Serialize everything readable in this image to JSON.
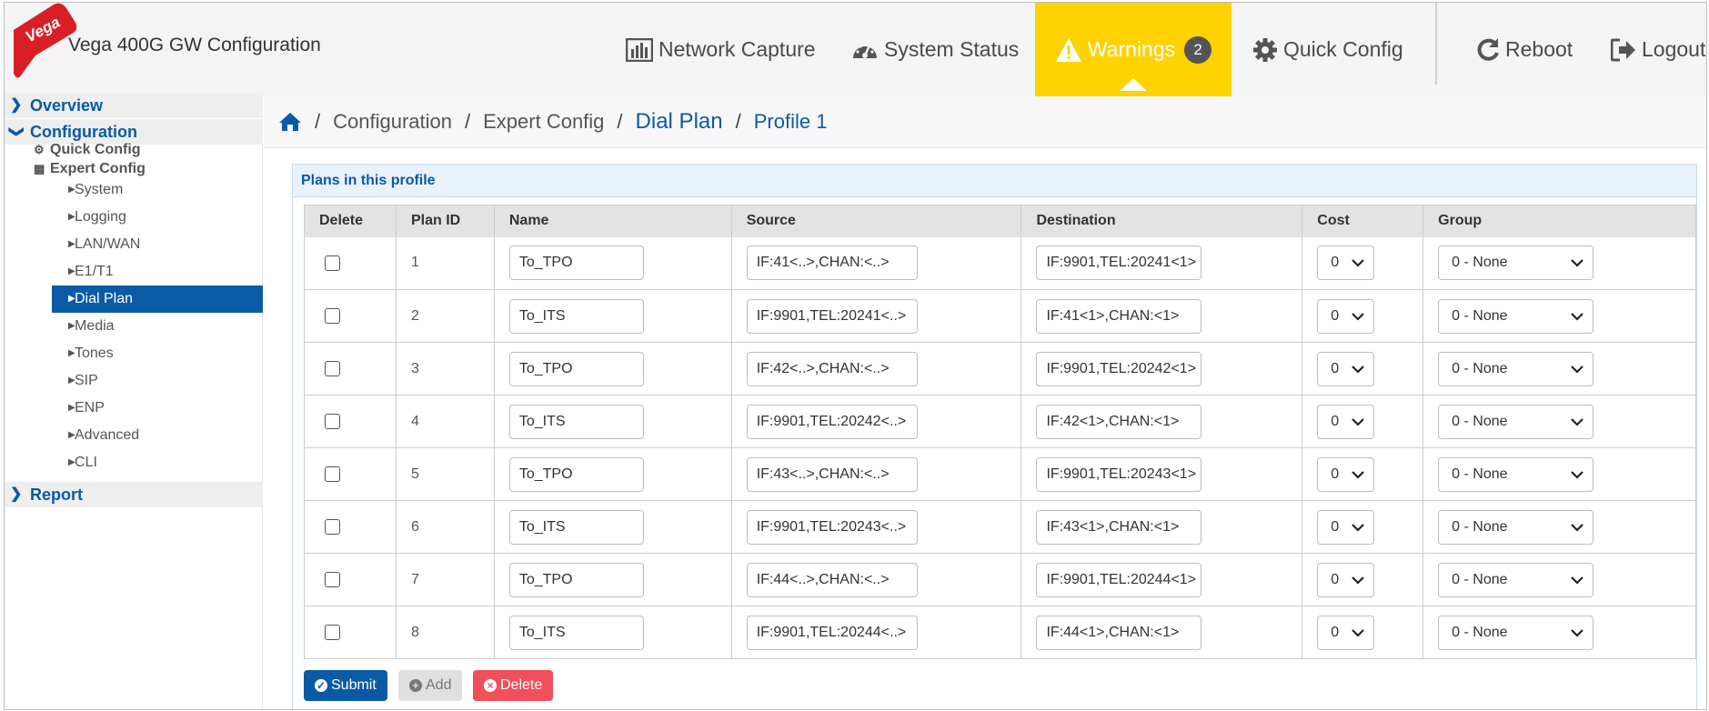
{
  "header": {
    "logo_text": "Vega",
    "title": "Vega 400G GW Configuration",
    "nav": {
      "network_capture": "Network Capture",
      "system_status": "System Status",
      "warnings": "Warnings",
      "warnings_count": "2",
      "quick_config": "Quick Config",
      "reboot": "Reboot",
      "logout": "Logout"
    },
    "warnings_color": "#ffd200",
    "accent": "#0b5aa5"
  },
  "sidebar": {
    "overview": "Overview",
    "configuration": "Configuration",
    "quick_config": "Quick Config",
    "expert_config": "Expert Config",
    "items": [
      {
        "label": "System"
      },
      {
        "label": "Logging"
      },
      {
        "label": "LAN/WAN"
      },
      {
        "label": "E1/T1"
      },
      {
        "label": "Dial Plan"
      },
      {
        "label": "Media"
      },
      {
        "label": "Tones"
      },
      {
        "label": "SIP"
      },
      {
        "label": "ENP"
      },
      {
        "label": "Advanced"
      },
      {
        "label": "CLI"
      }
    ],
    "active_item": "Dial Plan",
    "report": "Report"
  },
  "breadcrumb": {
    "home_icon": "home-icon",
    "items": [
      "Configuration",
      "Expert Config",
      "Dial Plan",
      "Profile 1"
    ],
    "separator": "/"
  },
  "panel": {
    "title": "Plans in this profile",
    "columns": [
      "Delete",
      "Plan ID",
      "Name",
      "Source",
      "Destination",
      "Cost",
      "Group"
    ],
    "rows": [
      {
        "id": "1",
        "name": "To_TPO",
        "source": "IF:41<..>,CHAN:<..>",
        "destination": "IF:9901,TEL:20241<1>",
        "cost": "0",
        "group": "0 - None"
      },
      {
        "id": "2",
        "name": "To_ITS",
        "source": "IF:9901,TEL:20241<..>",
        "destination": "IF:41<1>,CHAN:<1>",
        "cost": "0",
        "group": "0 - None"
      },
      {
        "id": "3",
        "name": "To_TPO",
        "source": "IF:42<..>,CHAN:<..>",
        "destination": "IF:9901,TEL:20242<1>",
        "cost": "0",
        "group": "0 - None"
      },
      {
        "id": "4",
        "name": "To_ITS",
        "source": "IF:9901,TEL:20242<..>",
        "destination": "IF:42<1>,CHAN:<1>",
        "cost": "0",
        "group": "0 - None"
      },
      {
        "id": "5",
        "name": "To_TPO",
        "source": "IF:43<..>,CHAN:<..>",
        "destination": "IF:9901,TEL:20243<1>",
        "cost": "0",
        "group": "0 - None"
      },
      {
        "id": "6",
        "name": "To_ITS",
        "source": "IF:9901,TEL:20243<..>",
        "destination": "IF:43<1>,CHAN:<1>",
        "cost": "0",
        "group": "0 - None"
      },
      {
        "id": "7",
        "name": "To_TPO",
        "source": "IF:44<..>,CHAN:<..>",
        "destination": "IF:9901,TEL:20244<1>",
        "cost": "0",
        "group": "0 - None"
      },
      {
        "id": "8",
        "name": "To_ITS",
        "source": "IF:9901,TEL:20244<..>",
        "destination": "IF:44<1>,CHAN:<1>",
        "cost": "0",
        "group": "0 - None"
      }
    ]
  },
  "buttons": {
    "submit": "Submit",
    "add": "Add",
    "delete": "Delete"
  }
}
